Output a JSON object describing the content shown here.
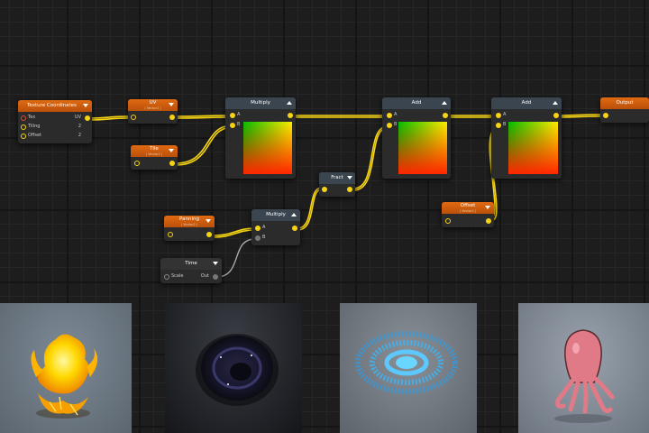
{
  "nodes": {
    "texcoord": {
      "title": "Texture Coordinates",
      "rows": [
        {
          "label": "Tex",
          "value": "UV"
        },
        {
          "label": "Tiling",
          "value": "2"
        },
        {
          "label": "Offset",
          "value": "2"
        }
      ]
    },
    "uv": {
      "title": "UV",
      "subtitle": "( Vector2 )"
    },
    "tile": {
      "title": "Tile",
      "subtitle": "( Vector2 )"
    },
    "multiply1": {
      "title": "Multiply",
      "inputs": [
        "A",
        "B"
      ]
    },
    "add1": {
      "title": "Add",
      "inputs": [
        "A",
        "B"
      ]
    },
    "add2": {
      "title": "Add",
      "inputs": [
        "A",
        "B"
      ]
    },
    "output": {
      "title": "Output"
    },
    "frac": {
      "title": "Fract"
    },
    "panning": {
      "title": "Panning",
      "subtitle": "( Vector2 )"
    },
    "multiply2": {
      "title": "Multiply",
      "inputs": [
        "A",
        "B"
      ]
    },
    "offset": {
      "title": "Offset",
      "subtitle": "( Vector2 )"
    },
    "time": {
      "title": "Time",
      "input": "Scale",
      "output": "Out"
    }
  },
  "previews": [
    "fire-effect",
    "black-hole-effect",
    "ripple-rings-effect",
    "octopus-character"
  ],
  "colors": {
    "wire": "#f6d414",
    "header_orange": "#d15e0e",
    "header_dark": "#3a4550",
    "node_bg": "#2b2b2b"
  }
}
